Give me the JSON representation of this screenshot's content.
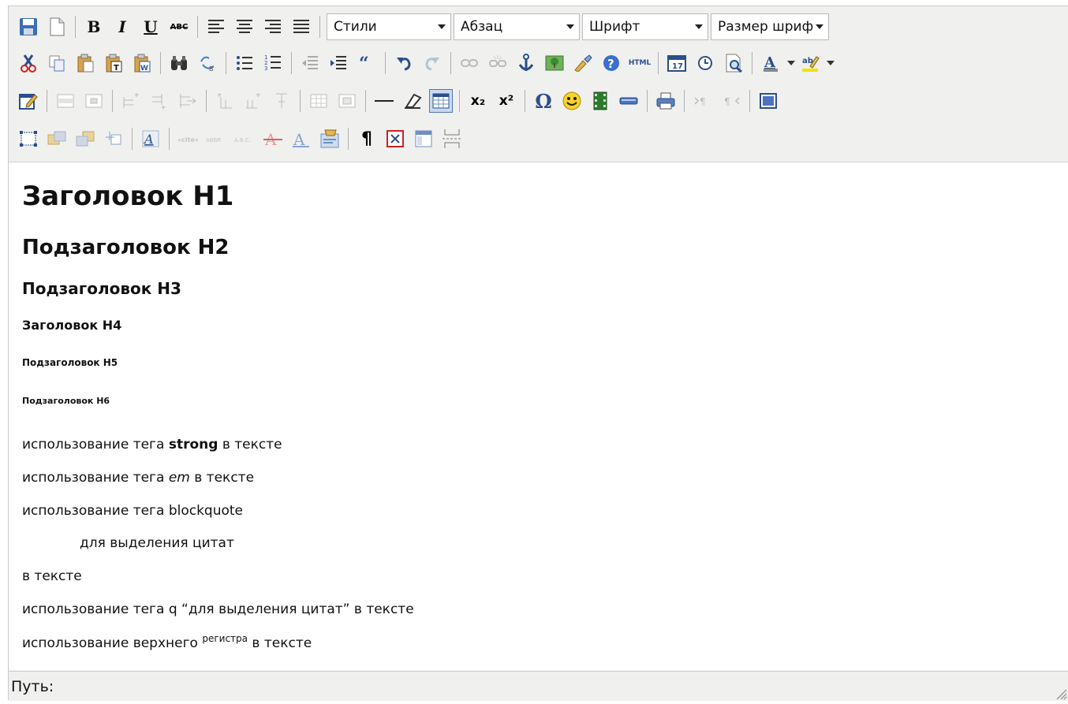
{
  "toolbar": {
    "bold_label": "B",
    "italic_label": "I",
    "underline_label": "U",
    "strike_label": "ABC",
    "html_label": "HTML",
    "subscript_label": "x₂",
    "superscript_label": "x²",
    "omega_label": "Ω",
    "pilcrow_label": "¶",
    "styles": {
      "value": "Стили"
    },
    "paragraph": {
      "value": "Абзац"
    },
    "font": {
      "value": "Шрифт"
    },
    "font_size": {
      "value": "Размер шриф·"
    },
    "icons_row1": [
      "save-icon",
      "new-document-icon",
      "bold-icon",
      "italic-icon",
      "underline-icon",
      "strikethrough-icon",
      "align-left-icon",
      "align-center-icon",
      "align-right-icon",
      "align-justify-icon"
    ],
    "icons_row2": [
      "cut-icon",
      "copy-icon",
      "paste-icon",
      "paste-text-icon",
      "paste-word-icon",
      "find-icon",
      "replace-icon",
      "bullet-list-icon",
      "numbered-list-icon",
      "outdent-icon",
      "indent-icon",
      "blockquote-icon",
      "undo-icon",
      "redo-icon",
      "link-icon",
      "unlink-icon",
      "anchor-icon",
      "image-icon",
      "cleanup-icon",
      "help-icon",
      "html-icon",
      "insert-date-icon",
      "insert-time-icon",
      "preview-icon",
      "text-color-icon",
      "highlight-color-icon"
    ],
    "icons_row3": [
      "edit-icon",
      "row-props-icon",
      "cell-props-icon",
      "insert-row-before-icon",
      "insert-row-after-icon",
      "delete-row-icon",
      "insert-col-before-icon",
      "insert-col-after-icon",
      "delete-col-icon",
      "split-cells-icon",
      "merge-cells-icon",
      "horizontal-rule-icon",
      "remove-format-icon",
      "table-icon",
      "subscript-icon",
      "superscript-icon",
      "special-char-icon",
      "emoticon-icon",
      "media-icon",
      "advanced-hr-icon",
      "print-icon",
      "ltr-icon",
      "rtl-icon",
      "fullscreen-icon"
    ],
    "icons_row4": [
      "insert-layer-icon",
      "move-forward-icon",
      "move-backward-icon",
      "absolute-icon",
      "style-props-icon",
      "cite-icon",
      "abbr-icon",
      "acronym-icon",
      "del-icon",
      "ins-icon",
      "attributes-icon",
      "visual-chars-icon",
      "non-breaking-icon",
      "template-icon",
      "page-break-icon"
    ]
  },
  "content": {
    "h1": "Заголовок H1",
    "h2": "Подзаголовок H2",
    "h3": "Подзаголовок H3",
    "h4": "Заголовок H4",
    "h5": "Подзаголовок H5",
    "h6": "Подзаголовок H6",
    "p1": {
      "before": "использование тега ",
      "strong": "strong",
      "after": " в тексте"
    },
    "p2": {
      "before": "использование тега ",
      "em": "em",
      "after": " в тексте"
    },
    "p3": "использование тега blockquote",
    "p4": "для выделения цитат",
    "p5": "в тексте",
    "p6": "использование тега q “для выделения цитат” в тексте",
    "p7": {
      "before": "использование верхнего ",
      "sup": "регистра",
      "after": " в тексте"
    }
  },
  "status": {
    "path_label": "Путь:"
  },
  "colors": {
    "toolbar_bg": "#f0f0ee",
    "active_border": "#4e77b5",
    "active_bg": "#c8d9f1"
  }
}
